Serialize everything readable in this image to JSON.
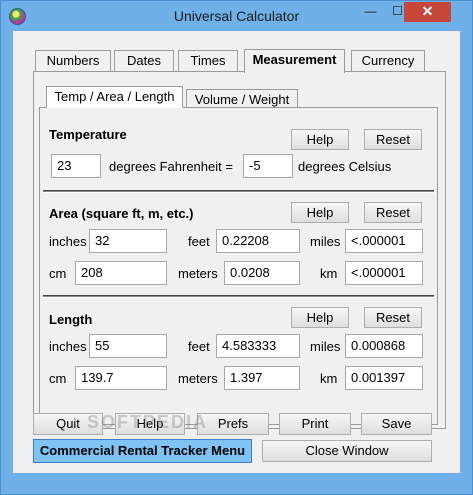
{
  "window": {
    "title": "Universal Calculator",
    "minimize_glyph": "—",
    "maximize_glyph": "☐",
    "close_glyph": "✕"
  },
  "main_tabs": [
    "Numbers",
    "Dates",
    "Times",
    "Measurement",
    "Currency"
  ],
  "active_main_tab": "Measurement",
  "sub_tabs": [
    "Temp / Area / Length",
    "Volume / Weight"
  ],
  "active_sub_tab": "Temp / Area / Length",
  "temperature": {
    "heading": "Temperature",
    "help_label": "Help",
    "reset_label": "Reset",
    "fahrenheit_value": "23",
    "fahrenheit_label": "degrees Fahrenheit  =",
    "celsius_value": "-5",
    "celsius_label": "degrees Celsius"
  },
  "area": {
    "heading": "Area (square ft, m, etc.)",
    "help_label": "Help",
    "reset_label": "Reset",
    "inches_label": "inches",
    "inches_value": "32",
    "feet_label": "feet",
    "feet_value": "0.22208",
    "miles_label": "miles",
    "miles_value": "<.000001",
    "cm_label": "cm",
    "cm_value": "208",
    "meters_label": "meters",
    "meters_value": "0.0208",
    "km_label": "km",
    "km_value": "<.000001"
  },
  "length": {
    "heading": "Length",
    "help_label": "Help",
    "reset_label": "Reset",
    "inches_label": "inches",
    "inches_value": "55",
    "feet_label": "feet",
    "feet_value": "4.583333",
    "miles_label": "miles",
    "miles_value": "0.000868",
    "cm_label": "cm",
    "cm_value": "139.7",
    "meters_label": "meters",
    "meters_value": "1.397",
    "km_label": "km",
    "km_value": "0.001397"
  },
  "bottom_buttons": {
    "quit": "Quit",
    "help": "Help",
    "prefs": "Prefs",
    "print": "Print",
    "save": "Save",
    "rental_tracker": "Commercial Rental Tracker Menu",
    "close_window": "Close Window"
  },
  "watermark": "SOFTPEDIA",
  "colors": {
    "title_bar": "#6fb0e8",
    "close_button": "#c7473a",
    "rental_button": "#7fc2f4"
  },
  "icons": {
    "app": "app-logo-icon"
  }
}
